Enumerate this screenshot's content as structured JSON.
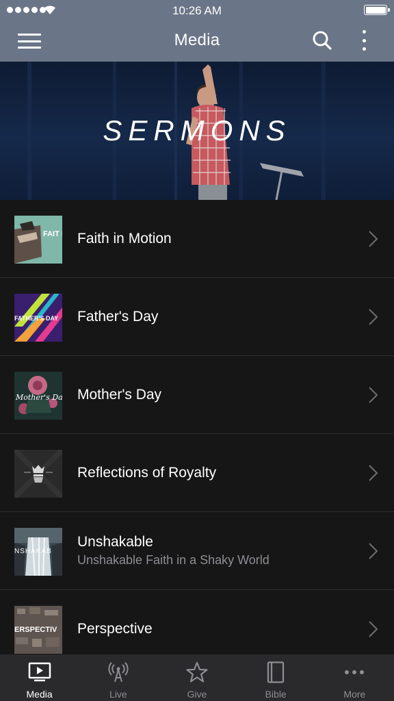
{
  "status_bar": {
    "time": "10:26 AM"
  },
  "nav": {
    "title": "Media"
  },
  "hero": {
    "title": "SERMONS"
  },
  "items": [
    {
      "title": "Faith in Motion",
      "subtitle": "",
      "thumb_text": "FAIT IN MOT"
    },
    {
      "title": "Father's Day",
      "subtitle": "",
      "thumb_text": "FATHER'S DAY"
    },
    {
      "title": "Mother's Day",
      "subtitle": "",
      "thumb_text": "Mother's Da"
    },
    {
      "title": "Reflections of Royalty",
      "subtitle": "",
      "thumb_text": ""
    },
    {
      "title": "Unshakable",
      "subtitle": "Unshakable Faith in a Shaky World",
      "thumb_text": "NSHAKAB"
    },
    {
      "title": "Perspective",
      "subtitle": "",
      "thumb_text": "ERSPECTIV"
    }
  ],
  "tabs": [
    {
      "label": "Media",
      "icon": "media-icon",
      "active": true
    },
    {
      "label": "Live",
      "icon": "broadcast-icon",
      "active": false
    },
    {
      "label": "Give",
      "icon": "star-icon",
      "active": false
    },
    {
      "label": "Bible",
      "icon": "book-icon",
      "active": false
    },
    {
      "label": "More",
      "icon": "ellipsis-icon",
      "active": false
    }
  ],
  "colors": {
    "topbar": "#6b7588",
    "background": "#161617",
    "tabbar": "#2a2a2c",
    "inactive": "#8e8e93"
  }
}
